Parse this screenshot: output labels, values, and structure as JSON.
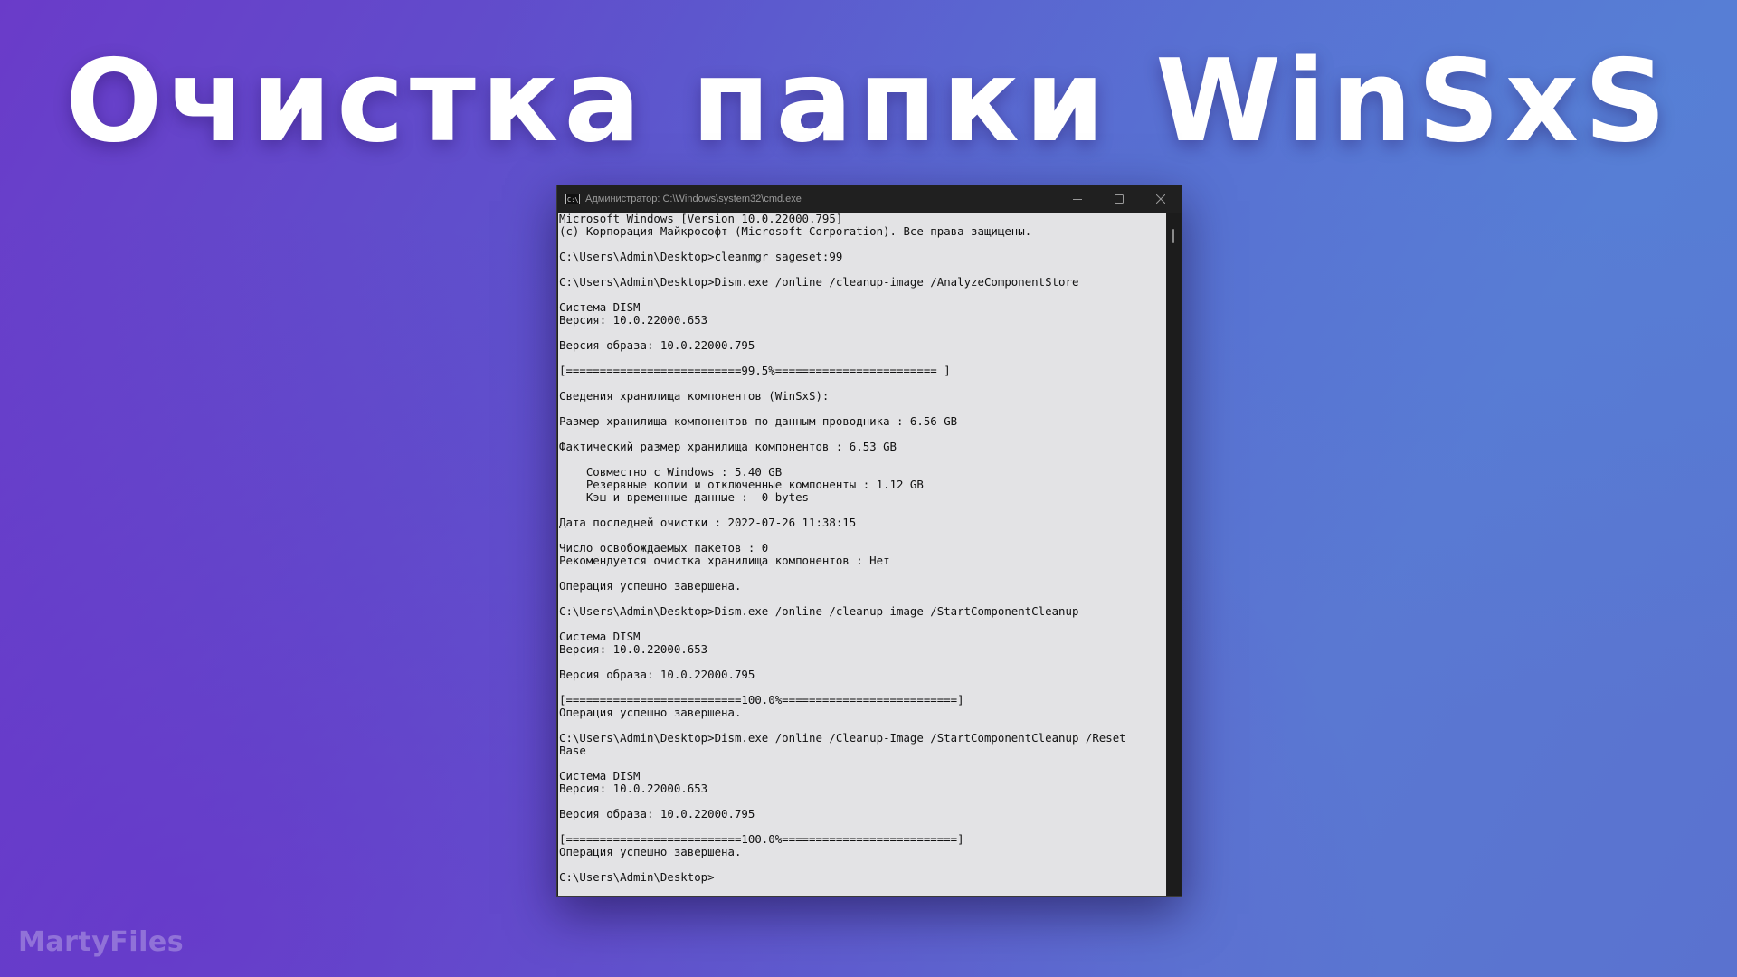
{
  "page": {
    "headline": "Очистка папки WinSxS",
    "watermark": "MartyFiles"
  },
  "window": {
    "title": "Администратор: C:\\Windows\\system32\\cmd.exe",
    "app_icon_text": "C:\\",
    "controls": [
      "minimize",
      "maximize",
      "close"
    ]
  },
  "console": {
    "lines": [
      "Microsoft Windows [Version 10.0.22000.795]",
      "(c) Корпорация Майкрософт (Microsoft Corporation). Все права защищены.",
      "",
      "C:\\Users\\Admin\\Desktop>cleanmgr sageset:99",
      "",
      "C:\\Users\\Admin\\Desktop>Dism.exe /online /cleanup-image /AnalyzeComponentStore",
      "",
      "Cистема DISM",
      "Версия: 10.0.22000.653",
      "",
      "Версия образа: 10.0.22000.795",
      "",
      "[==========================99.5%======================== ]",
      "",
      "Сведения хранилища компонентов (WinSxS):",
      "",
      "Размер хранилища компонентов по данным проводника : 6.56 GB",
      "",
      "Фактический размер хранилища компонентов : 6.53 GB",
      "",
      "    Совместно с Windows : 5.40 GB",
      "    Резервные копии и отключенные компоненты : 1.12 GB",
      "    Кэш и временные данные :  0 bytes",
      "",
      "Дата последней очистки : 2022-07-26 11:38:15",
      "",
      "Число освобождаемых пакетов : 0",
      "Рекомендуется очистка хранилища компонентов : Нет",
      "",
      "Операция успешно завершена.",
      "",
      "C:\\Users\\Admin\\Desktop>Dism.exe /online /cleanup-image /StartComponentCleanup",
      "",
      "Cистема DISM",
      "Версия: 10.0.22000.653",
      "",
      "Версия образа: 10.0.22000.795",
      "",
      "[==========================100.0%==========================]",
      "Операция успешно завершена.",
      "",
      "C:\\Users\\Admin\\Desktop>Dism.exe /online /Cleanup-Image /StartComponentCleanup /Reset",
      "Base",
      "",
      "Cистема DISM",
      "Версия: 10.0.22000.653",
      "",
      "Версия образа: 10.0.22000.795",
      "",
      "[==========================100.0%==========================]",
      "Операция успешно завершена.",
      "",
      "C:\\Users\\Admin\\Desktop>"
    ]
  },
  "colors": {
    "console_background": "#e3e3e5",
    "console_text": "#111111",
    "titlebar": "#202020",
    "headline": "#ffffff"
  }
}
